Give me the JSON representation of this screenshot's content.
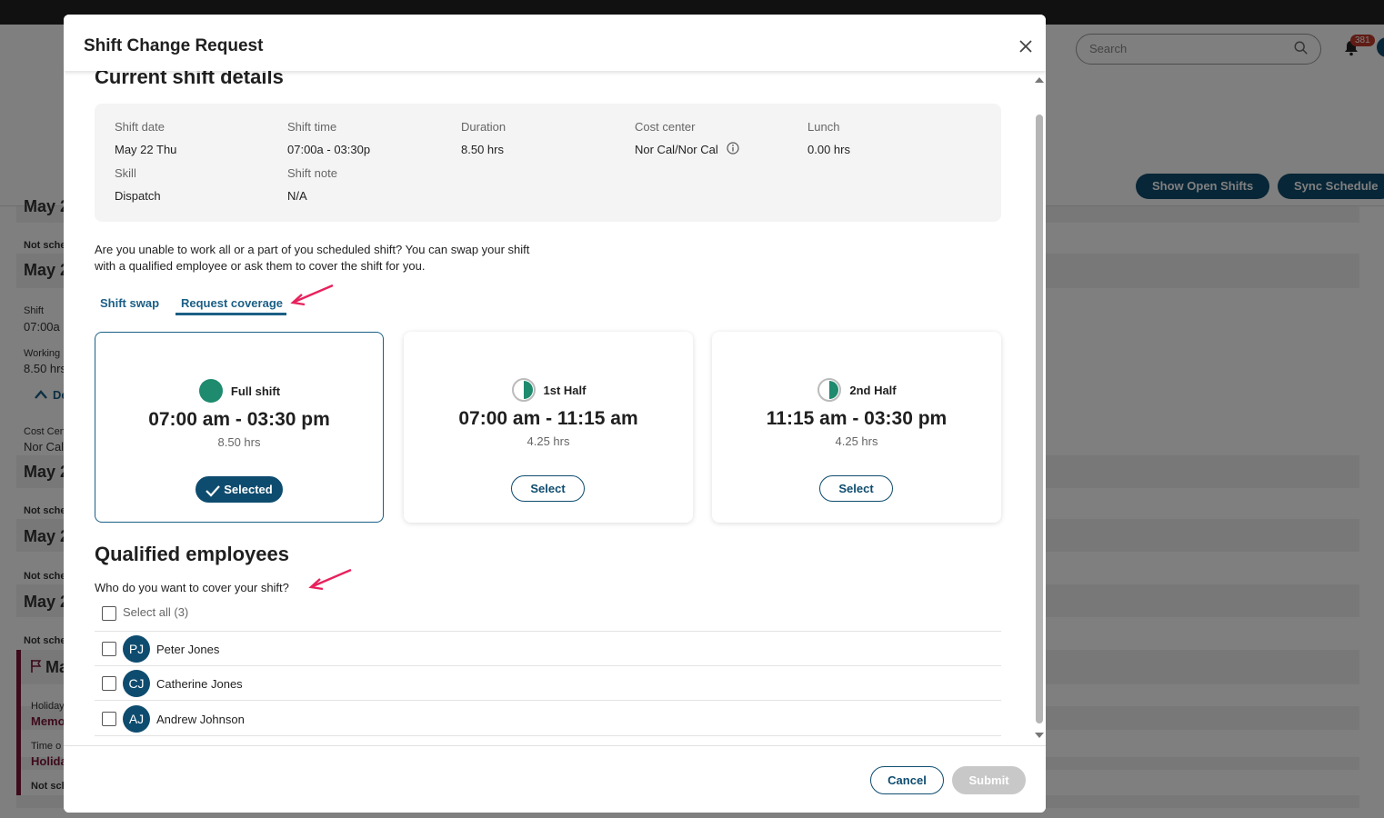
{
  "background": {
    "search_placeholder": "Search",
    "notification_count": "381",
    "show_open_shifts": "Show Open Shifts",
    "sync_schedule": "Sync Schedule",
    "left_fragments": [
      "May 2",
      "Not sche",
      "May 2",
      "Shift",
      "07:00a",
      "Working",
      "8.50 hrs",
      "De",
      "Cost Cen",
      "Nor Cal",
      "May 2",
      "Not sche",
      "May 2",
      "Not sche",
      "May 2",
      "Not sche",
      "Ma",
      "Holiday",
      "Memo",
      "Time o",
      "Holida",
      "Not sch"
    ]
  },
  "modal": {
    "title": "Shift Change Request",
    "current_details_heading": "Current shift details",
    "details": {
      "shift_date_label": "Shift date",
      "shift_date_value": "May 22 Thu",
      "shift_time_label": "Shift time",
      "shift_time_value": "07:00a - 03:30p",
      "duration_label": "Duration",
      "duration_value": "8.50 hrs",
      "cost_center_label": "Cost center",
      "cost_center_value": "Nor Cal/Nor Cal",
      "lunch_label": "Lunch",
      "lunch_value": "0.00 hrs",
      "skill_label": "Skill",
      "skill_value": "Dispatch",
      "shift_note_label": "Shift note",
      "shift_note_value": "N/A"
    },
    "intro_line1": "Are you unable to work all or a part of you scheduled shift? You can swap your shift",
    "intro_line2": "with a qualified employee or ask them to cover the shift for you.",
    "tabs": [
      {
        "label": "Shift swap",
        "active": false
      },
      {
        "label": "Request coverage",
        "active": true
      }
    ],
    "cards": [
      {
        "kind": "Full shift",
        "time": "07:00 am - 03:30 pm",
        "hours": "8.50 hrs",
        "button": "Selected",
        "selected": true
      },
      {
        "kind": "1st Half",
        "time": "07:00 am - 11:15 am",
        "hours": "4.25 hrs",
        "button": "Select",
        "selected": false
      },
      {
        "kind": "2nd Half",
        "time": "11:15 am - 03:30 pm",
        "hours": "4.25 hrs",
        "button": "Select",
        "selected": false
      }
    ],
    "qualified_heading": "Qualified employees",
    "qualified_question": "Who do you want to cover your shift?",
    "select_all_label": "Select all (3)",
    "employees": [
      {
        "initials": "PJ",
        "name": "Peter Jones"
      },
      {
        "initials": "CJ",
        "name": "Catherine Jones"
      },
      {
        "initials": "AJ",
        "name": "Andrew Johnson"
      }
    ],
    "cancel_label": "Cancel",
    "submit_label": "Submit"
  },
  "colors": {
    "primary": "#0e4c6f",
    "tab_blue": "#1b5f86",
    "full_shift_green": "#1e8a6e",
    "annotation_arrow": "#e8215c",
    "disabled_button": "#c8c8c8"
  }
}
